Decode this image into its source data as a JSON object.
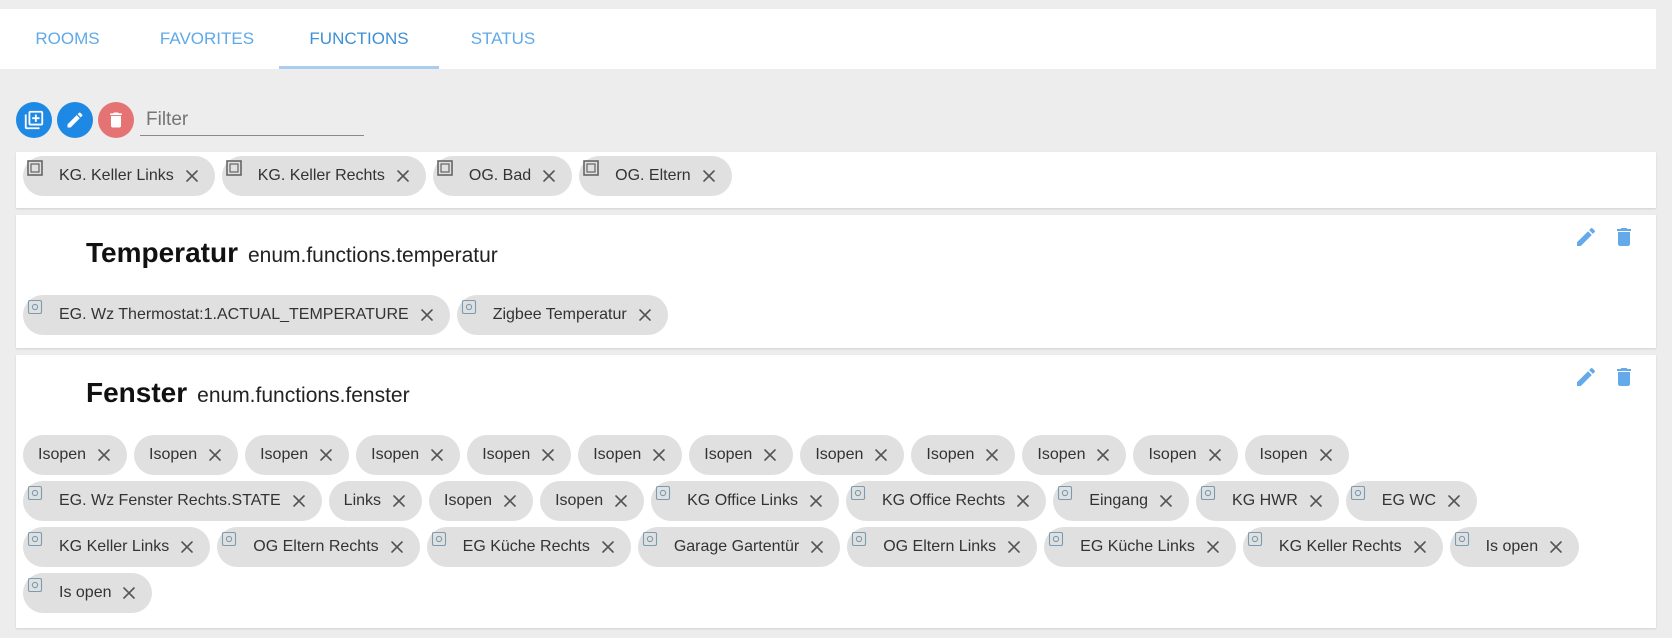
{
  "tabs": [
    {
      "label": "ROOMS"
    },
    {
      "label": "FAVORITES"
    },
    {
      "label": "FUNCTIONS"
    },
    {
      "label": "STATUS"
    }
  ],
  "active_tab": "FUNCTIONS",
  "toolbar": {
    "filter_placeholder": "Filter"
  },
  "colors": {
    "accent": "#1e88e5",
    "delete": "#e57373",
    "tab_text": "#5fa9e8",
    "chip_bg": "#e0e0e0"
  },
  "top_card": {
    "chips": [
      {
        "label": "KG. Keller Links",
        "icon": "device-window-icon"
      },
      {
        "label": "KG. Keller Rechts",
        "icon": "device-window-icon"
      },
      {
        "label": "OG. Bad",
        "icon": "device-window-icon"
      },
      {
        "label": "OG. Eltern",
        "icon": "device-window-icon"
      }
    ]
  },
  "temperatur": {
    "title": "Temperatur",
    "id": "enum.functions.temperatur",
    "chips": [
      {
        "label": "EG. Wz Thermostat:1.ACTUAL_TEMPERATURE",
        "icon": "state-icon"
      },
      {
        "label": "Zigbee Temperatur",
        "icon": "state-icon"
      }
    ]
  },
  "fenster": {
    "title": "Fenster",
    "id": "enum.functions.fenster",
    "rows": [
      [
        {
          "label": "Isopen"
        },
        {
          "label": "Isopen"
        },
        {
          "label": "Isopen"
        },
        {
          "label": "Isopen"
        },
        {
          "label": "Isopen"
        },
        {
          "label": "Isopen"
        },
        {
          "label": "Isopen"
        },
        {
          "label": "Isopen"
        },
        {
          "label": "Isopen"
        },
        {
          "label": "Isopen"
        },
        {
          "label": "Isopen"
        },
        {
          "label": "Isopen"
        }
      ],
      [
        {
          "label": "EG. Wz Fenster Rechts.STATE",
          "icon": "state-icon"
        },
        {
          "label": "Links"
        },
        {
          "label": "Isopen"
        },
        {
          "label": "Isopen"
        },
        {
          "label": "KG Office Links",
          "icon": "state-icon"
        },
        {
          "label": "KG Office Rechts",
          "icon": "state-icon"
        },
        {
          "label": "Eingang",
          "icon": "state-icon"
        },
        {
          "label": "KG HWR",
          "icon": "state-icon"
        },
        {
          "label": "EG WC",
          "icon": "state-icon"
        }
      ],
      [
        {
          "label": "KG Keller Links",
          "icon": "state-icon"
        },
        {
          "label": "OG Eltern Rechts",
          "icon": "state-icon"
        },
        {
          "label": "EG Küche Rechts",
          "icon": "state-icon"
        },
        {
          "label": "Garage Gartentür",
          "icon": "state-icon"
        },
        {
          "label": "OG Eltern Links",
          "icon": "state-icon"
        },
        {
          "label": "EG Küche Links",
          "icon": "state-icon"
        },
        {
          "label": "KG Keller Rechts",
          "icon": "state-icon"
        },
        {
          "label": "Is open",
          "icon": "state-icon"
        }
      ],
      [
        {
          "label": "Is open",
          "icon": "state-icon"
        }
      ]
    ]
  }
}
